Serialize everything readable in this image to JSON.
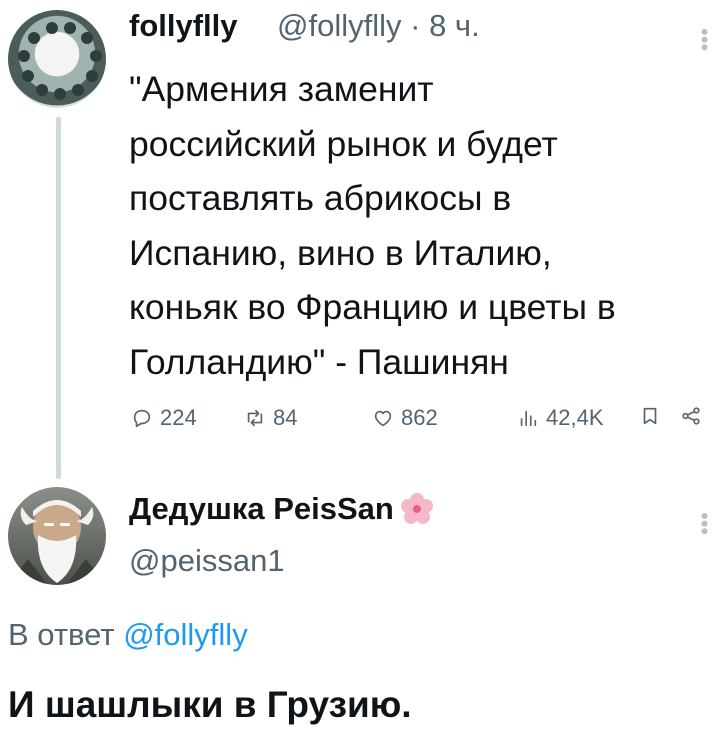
{
  "tweet1": {
    "display_name": "follyflly",
    "handle": "@follyflly",
    "separator": "·",
    "time": "8 ч.",
    "text_lines": [
      "\"Армения заменит",
      "российский рынок и будет",
      "поставлять абрикосы в",
      "Испанию, вино в Италию,",
      "коньяк во Францию и цветы в",
      "Голландию\" - Пашинян"
    ],
    "actions": {
      "replies": "224",
      "retweets": "84",
      "likes": "862",
      "views": "42,4K"
    }
  },
  "tweet2": {
    "display_name": "Дедушка PeisSan",
    "handle": "@peissan1",
    "reply_prefix": "В ответ",
    "reply_mention": "@follyflly",
    "text": "И шашлыки в Грузию."
  },
  "colors": {
    "text": "#0f1419",
    "secondary": "#536471",
    "link": "#1d9bf0",
    "thread_line": "#cfd9de"
  },
  "icons": [
    "reply-icon",
    "retweet-icon",
    "like-icon",
    "views-icon",
    "bookmark-icon",
    "share-icon",
    "more-icon",
    "sakura-flower-icon"
  ]
}
